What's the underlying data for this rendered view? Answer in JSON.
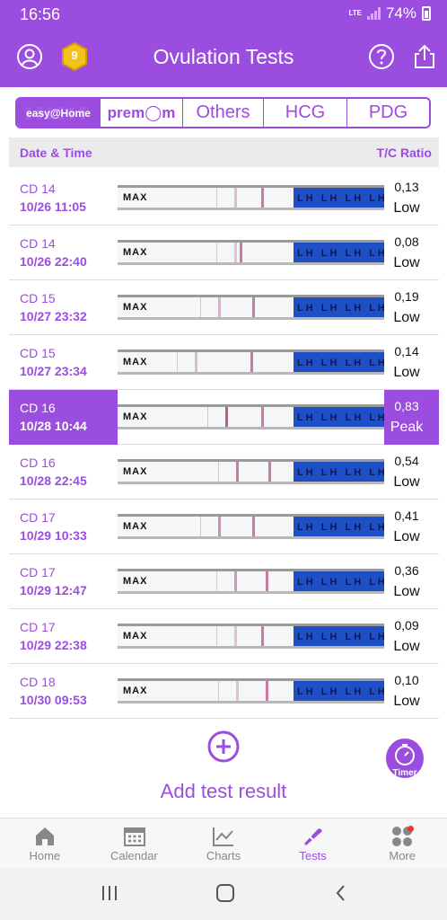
{
  "status": {
    "time": "16:56",
    "network": "LTE",
    "battery": "74%"
  },
  "header": {
    "title": "Ovulation Tests",
    "coin_count": "9"
  },
  "brand_tabs": [
    {
      "label": "easy@Home",
      "active": true
    },
    {
      "label": "prem◯m",
      "active": false
    },
    {
      "label": "Others",
      "active": false
    },
    {
      "label": "HCG",
      "active": false
    },
    {
      "label": "PDG",
      "active": false
    }
  ],
  "table": {
    "col_date": "Date & Time",
    "col_ratio": "T/C Ratio",
    "strip_max": "MAX",
    "strip_lh": "LH LH LH LH LH",
    "rows": [
      {
        "cd": "CD 14",
        "datetime": "10/26  11:05",
        "ratio": "0,13",
        "level": "Low",
        "peak": false
      },
      {
        "cd": "CD 14",
        "datetime": "10/26  22:40",
        "ratio": "0,08",
        "level": "Low",
        "peak": false
      },
      {
        "cd": "CD 15",
        "datetime": "10/27  23:32",
        "ratio": "0,19",
        "level": "Low",
        "peak": false
      },
      {
        "cd": "CD 15",
        "datetime": "10/27  23:34",
        "ratio": "0,14",
        "level": "Low",
        "peak": false
      },
      {
        "cd": "CD 16",
        "datetime": "10/28  10:44",
        "ratio": "0,83",
        "level": "Peak",
        "peak": true
      },
      {
        "cd": "CD 16",
        "datetime": "10/28  22:45",
        "ratio": "0,54",
        "level": "Low",
        "peak": false
      },
      {
        "cd": "CD 17",
        "datetime": "10/29  10:33",
        "ratio": "0,41",
        "level": "Low",
        "peak": false
      },
      {
        "cd": "CD 17",
        "datetime": "10/29  12:47",
        "ratio": "0,36",
        "level": "Low",
        "peak": false
      },
      {
        "cd": "CD 17",
        "datetime": "10/29  22:38",
        "ratio": "0,09",
        "level": "Low",
        "peak": false
      },
      {
        "cd": "CD 18",
        "datetime": "10/30  09:53",
        "ratio": "0,10",
        "level": "Low",
        "peak": false
      }
    ]
  },
  "add_result_label": "Add test result",
  "timer_label": "Timer",
  "bottom_nav": [
    {
      "label": "Home",
      "icon": "home-icon",
      "active": false
    },
    {
      "label": "Calendar",
      "icon": "calendar-icon",
      "active": false
    },
    {
      "label": "Charts",
      "icon": "chart-icon",
      "active": false
    },
    {
      "label": "Tests",
      "icon": "test-strip-icon",
      "active": true
    },
    {
      "label": "More",
      "icon": "more-icon",
      "active": false
    }
  ],
  "colors": {
    "accent": "#9b4de0",
    "test_blue": "#1e4fc7",
    "test_line": "#c05a8c"
  }
}
